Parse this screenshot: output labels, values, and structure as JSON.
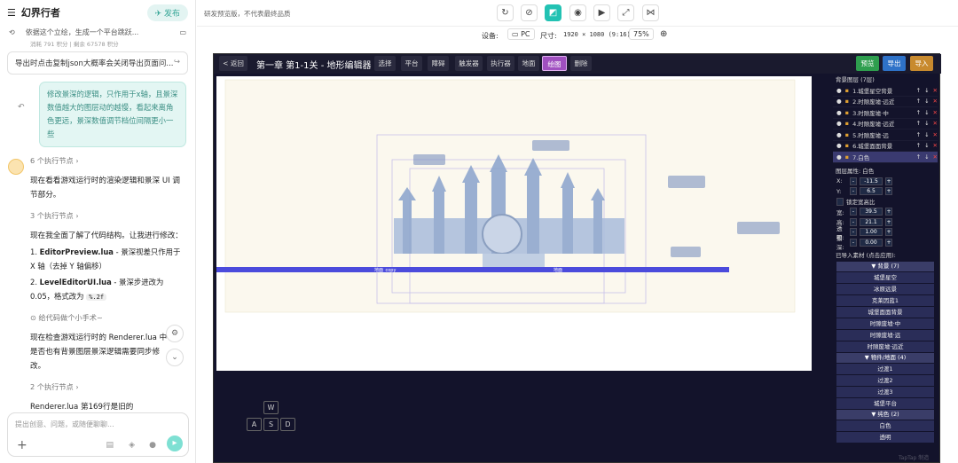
{
  "left": {
    "app_title": "幻界行者",
    "publish_label": "发布",
    "subtitle": "依据这个立绘，生成一个平台跳跃...",
    "meta": "消耗 791 积分 | 剩余 67578 积分",
    "banner_text": "导出时点击复制json大概率会关闭导出页面问...",
    "user_message": "修改景深的逻辑，只作用于x轴，且景深数值越大的图层动的越慢，看起来离角色更远，景深数值调节档位间隔更小一些",
    "step1": "6 个执行节点",
    "para1": "现在看看游戏运行时的渲染逻辑和景深 UI 调节部分。",
    "step2": "3 个执行节点",
    "para2": "现在我全面了解了代码结构。让我进行修改：",
    "li1_title": "EditorPreview.lua",
    "li1_text": " - 景深视差只作用于 X 轴（去掉 Y 轴偏移）",
    "li2_title": "LevelEditorUI.lua",
    "li2_text": " - 景深步进改为 0.05，格式改为 ",
    "li2_code": "%.2f",
    "step3": "给代码做个小手术~",
    "para3": "现在检查游戏运行时的 Renderer.lua 中是否也有背景图层景深逻辑需要同步修改。",
    "step4": "2 个执行节点",
    "para4": "Renderer.lua 第169行是旧的 parallaxLayers",
    "input_placeholder": "提出创意、问题，或随便聊聊..."
  },
  "topbar": {
    "tip": "研发预览版，不代表最终品质",
    "device_label": "设备:",
    "device_value": "PC",
    "size_label": "尺寸:",
    "size_value": "1920 × 1080 (9:16)",
    "zoom": "75%"
  },
  "editor": {
    "back": "< 返回",
    "title": "第一章 第1-1关 - 地形编辑器",
    "tools": [
      "选择",
      "平台",
      "障碍",
      "触发器",
      "执行器",
      "地面",
      "绘图",
      "删除"
    ],
    "preview": "预览",
    "export": "导出",
    "import": "导入",
    "canvas_label1": "地面_copy",
    "canvas_label2": "地面",
    "keys": [
      "W",
      "A",
      "S",
      "D"
    ],
    "watermark": "TapTap 制造"
  },
  "panel": {
    "layers_title": "背景图层 (7层)",
    "layers": [
      "1.城堡星空背景",
      "2.时隙废墟·远近",
      "3.时隙废墟·中",
      "4.时隙废墟·远近",
      "5.时隙废墟·远",
      "6.城堡面面背景",
      "7.白色"
    ],
    "props_title": "图层属性: 白色",
    "x_label": "X:",
    "x_value": "-11.5",
    "y_label": "Y:",
    "y_value": "6.5",
    "lock_label": "锁定宽高比",
    "w_label": "宽:",
    "w_value": "39.5",
    "h_label": "高:",
    "h_value": "21.1",
    "a_label": "透明:",
    "a_value": "1.00",
    "d_label": "景深:",
    "d_value": "0.00",
    "imported_title": "已导入素材 (点击应用):",
    "group1": "▼ 背景 (7)",
    "group1_items": [
      "城堡星空",
      "冰原远景",
      "克莱因蓝1",
      "城堡面面背景",
      "时隙废墟·中",
      "时隙废墟·远",
      "时隙废墟·远近"
    ],
    "group2": "▼ 物件/地面 (4)",
    "group2_items": [
      "过渡1",
      "过渡2",
      "过渡3",
      "城堡平台"
    ],
    "group3": "▼ 纯色 (2)",
    "group3_items": [
      "白色",
      "透明"
    ]
  }
}
